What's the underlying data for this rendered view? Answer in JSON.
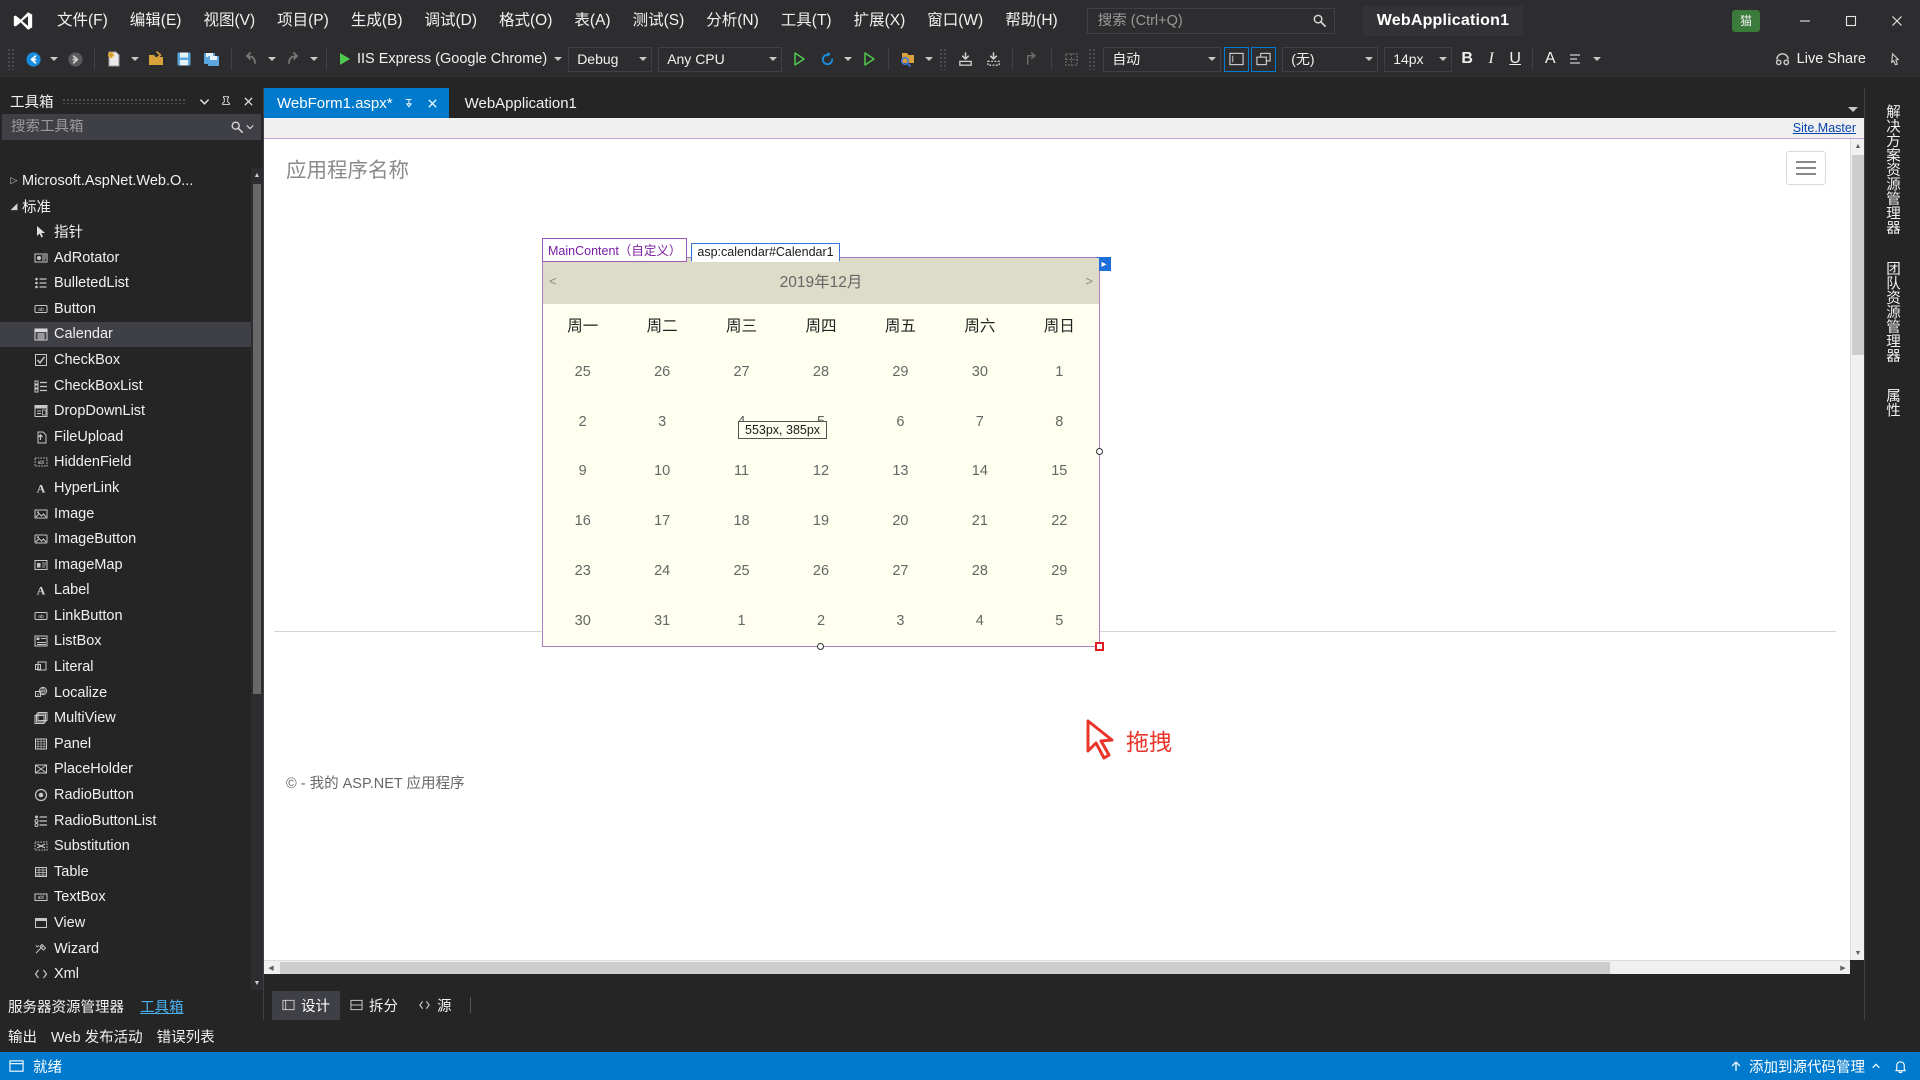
{
  "titlebar": {
    "logo_icon": "visual-studio-logo-icon",
    "menus": [
      "文件(F)",
      "编辑(E)",
      "视图(V)",
      "项目(P)",
      "生成(B)",
      "调试(D)",
      "格式(O)",
      "表(A)",
      "测试(S)",
      "分析(N)",
      "工具(T)",
      "扩展(X)",
      "窗口(W)",
      "帮助(H)"
    ],
    "search": {
      "placeholder": "搜索 (Ctrl+Q)",
      "value": "",
      "icon": "search-icon"
    },
    "solution_name": "WebApplication1",
    "notification_icon": "猫",
    "minimize": "—",
    "maximize": "▢",
    "close": "✕"
  },
  "toolbar": {
    "nav_back_icon": "navigate-back-icon",
    "nav_forward_icon": "navigate-forward-icon",
    "new_item_icon": "new-item-icon",
    "open_icon": "open-file-icon",
    "save_icon": "save-icon",
    "save_all_icon": "save-all-icon",
    "undo_icon": "undo-icon",
    "redo_icon": "redo-icon",
    "start_label": "IIS Express (Google Chrome)",
    "start_icon": "start-debug-icon",
    "configuration": "Debug",
    "platform": "Any CPU",
    "attach_icon": "attach-process-icon",
    "refresh_icon": "refresh-icon",
    "start_browser_icon": "start-browser-icon",
    "solution_explorer_icon": "solution-folder-icon",
    "collapse_icon": "collapse-icon",
    "expand_icon": "expand-icon",
    "goto_icon": "goto-icon",
    "table_icon": "table-icon",
    "block_format": "自动",
    "view_design_icon": "design-view-icon",
    "view_split_icon": "split-view-icon",
    "font_family": "(无)",
    "font_size": "14px",
    "bold": "B",
    "italic": "I",
    "underline": "U",
    "fore_color": "A",
    "align_icon": "align-icon",
    "live_share": "Live Share",
    "live_share_icon": "live-share-icon",
    "pin_icon": "pin-icon"
  },
  "toolbox": {
    "title": "工具箱",
    "pin_icon": "pin-icon",
    "close_icon": "close-icon",
    "chevron_icon": "chevron-down-icon",
    "search": {
      "placeholder": "搜索工具箱",
      "value": "",
      "icon": "search-icon",
      "dropdown_icon": "chevron-down-icon"
    },
    "groups": [
      {
        "label": "Microsoft.AspNet.Web.O...",
        "expanded": false,
        "arrow": "▷"
      },
      {
        "label": "标准",
        "expanded": true,
        "arrow": "◢"
      }
    ],
    "items": [
      {
        "label": "指针",
        "icon": "pointer-icon",
        "selected": false
      },
      {
        "label": "AdRotator",
        "icon": "adrotator-icon",
        "selected": false
      },
      {
        "label": "BulletedList",
        "icon": "bulletedlist-icon",
        "selected": false
      },
      {
        "label": "Button",
        "icon": "button-icon",
        "selected": false
      },
      {
        "label": "Calendar",
        "icon": "calendar-icon",
        "selected": true
      },
      {
        "label": "CheckBox",
        "icon": "checkbox-icon",
        "selected": false
      },
      {
        "label": "CheckBoxList",
        "icon": "checkboxlist-icon",
        "selected": false
      },
      {
        "label": "DropDownList",
        "icon": "dropdownlist-icon",
        "selected": false
      },
      {
        "label": "FileUpload",
        "icon": "fileupload-icon",
        "selected": false
      },
      {
        "label": "HiddenField",
        "icon": "hiddenfield-icon",
        "selected": false
      },
      {
        "label": "HyperLink",
        "icon": "hyperlink-icon",
        "selected": false
      },
      {
        "label": "Image",
        "icon": "image-icon",
        "selected": false
      },
      {
        "label": "ImageButton",
        "icon": "imagebutton-icon",
        "selected": false
      },
      {
        "label": "ImageMap",
        "icon": "imagemap-icon",
        "selected": false
      },
      {
        "label": "Label",
        "icon": "label-icon",
        "selected": false
      },
      {
        "label": "LinkButton",
        "icon": "linkbutton-icon",
        "selected": false
      },
      {
        "label": "ListBox",
        "icon": "listbox-icon",
        "selected": false
      },
      {
        "label": "Literal",
        "icon": "literal-icon",
        "selected": false
      },
      {
        "label": "Localize",
        "icon": "localize-icon",
        "selected": false
      },
      {
        "label": "MultiView",
        "icon": "multiview-icon",
        "selected": false
      },
      {
        "label": "Panel",
        "icon": "panel-icon",
        "selected": false
      },
      {
        "label": "PlaceHolder",
        "icon": "placeholder-icon",
        "selected": false
      },
      {
        "label": "RadioButton",
        "icon": "radiobutton-icon",
        "selected": false
      },
      {
        "label": "RadioButtonList",
        "icon": "radiobuttonlist-icon",
        "selected": false
      },
      {
        "label": "Substitution",
        "icon": "substitution-icon",
        "selected": false
      },
      {
        "label": "Table",
        "icon": "table-icon",
        "selected": false
      },
      {
        "label": "TextBox",
        "icon": "textbox-icon",
        "selected": false
      },
      {
        "label": "View",
        "icon": "view-icon",
        "selected": false
      },
      {
        "label": "Wizard",
        "icon": "wizard-icon",
        "selected": false
      },
      {
        "label": "Xml",
        "icon": "xml-icon",
        "selected": false
      }
    ],
    "footer_tabs": [
      {
        "label": "服务器资源管理器",
        "active": false
      },
      {
        "label": "工具箱",
        "active": true
      }
    ]
  },
  "document": {
    "tabs": [
      {
        "label": "WebForm1.aspx*",
        "active": true,
        "pin_icon": "pin-icon",
        "close_icon": "close-icon"
      },
      {
        "label": "WebApplication1",
        "active": false
      }
    ],
    "overflow_icon": "chevron-down-icon",
    "master_link": "Site.Master"
  },
  "designer": {
    "app_name_placeholder": "应用程序名称",
    "hamburger_icon": "hamburger-menu-icon",
    "tag_maincontent": "MainContent（自定义）",
    "tag_calendar": "asp:calendar#Calendar1",
    "size_tooltip": "553px, 385px",
    "annotation": "拖拽",
    "annotation_color": "#e8342b",
    "copyright": "© - 我的 ASP.NET 应用程序",
    "grip_icon": "smart-tag-icon",
    "view_tabs": [
      {
        "label": "设计",
        "active": true,
        "icon": "design-view-icon"
      },
      {
        "label": "拆分",
        "active": false,
        "icon": "split-view-icon"
      },
      {
        "label": "源",
        "active": false,
        "icon": "source-view-icon"
      }
    ]
  },
  "calendar": {
    "prev": "<",
    "next": ">",
    "title": "2019年12月",
    "daynames": [
      "周一",
      "周二",
      "周三",
      "周四",
      "周五",
      "周六",
      "周日"
    ],
    "weeks": [
      [
        "25",
        "26",
        "27",
        "28",
        "29",
        "30",
        "1"
      ],
      [
        "2",
        "3",
        "4",
        "5",
        "6",
        "7",
        "8"
      ],
      [
        "9",
        "10",
        "11",
        "12",
        "13",
        "14",
        "15"
      ],
      [
        "16",
        "17",
        "18",
        "19",
        "20",
        "21",
        "22"
      ],
      [
        "23",
        "24",
        "25",
        "26",
        "27",
        "28",
        "29"
      ],
      [
        "30",
        "31",
        "1",
        "2",
        "3",
        "4",
        "5"
      ]
    ],
    "header_bg": "#dcdcc8",
    "body_bg": "#fffff0"
  },
  "right_dock": {
    "items": [
      "解决方案资源管理器",
      "属性",
      "团队资源管理器"
    ]
  },
  "bottom_tabs": [
    {
      "label": "输出"
    },
    {
      "label": "Web 发布活动"
    },
    {
      "label": "错误列表"
    }
  ],
  "statusbar": {
    "status": "就绪",
    "status_icon": "ready-icon",
    "source_control": "添加到源代码管理",
    "source_control_icon": "upload-icon",
    "chevron_icon": "chevron-up-icon",
    "bell_icon": "notification-bell-icon",
    "accent": "#007acc"
  }
}
